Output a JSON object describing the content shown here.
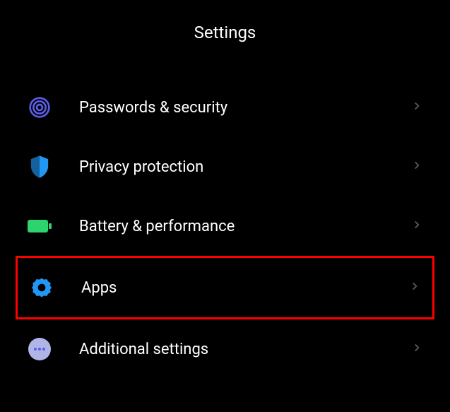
{
  "header": {
    "title": "Settings"
  },
  "items": [
    {
      "icon": "fingerprint-icon",
      "label": "Passwords & security",
      "highlighted": false
    },
    {
      "icon": "shield-icon",
      "label": "Privacy protection",
      "highlighted": false
    },
    {
      "icon": "battery-icon",
      "label": "Battery & performance",
      "highlighted": false
    },
    {
      "icon": "gear-icon",
      "label": "Apps",
      "highlighted": true
    },
    {
      "icon": "dots-icon",
      "label": "Additional settings",
      "highlighted": false
    }
  ]
}
